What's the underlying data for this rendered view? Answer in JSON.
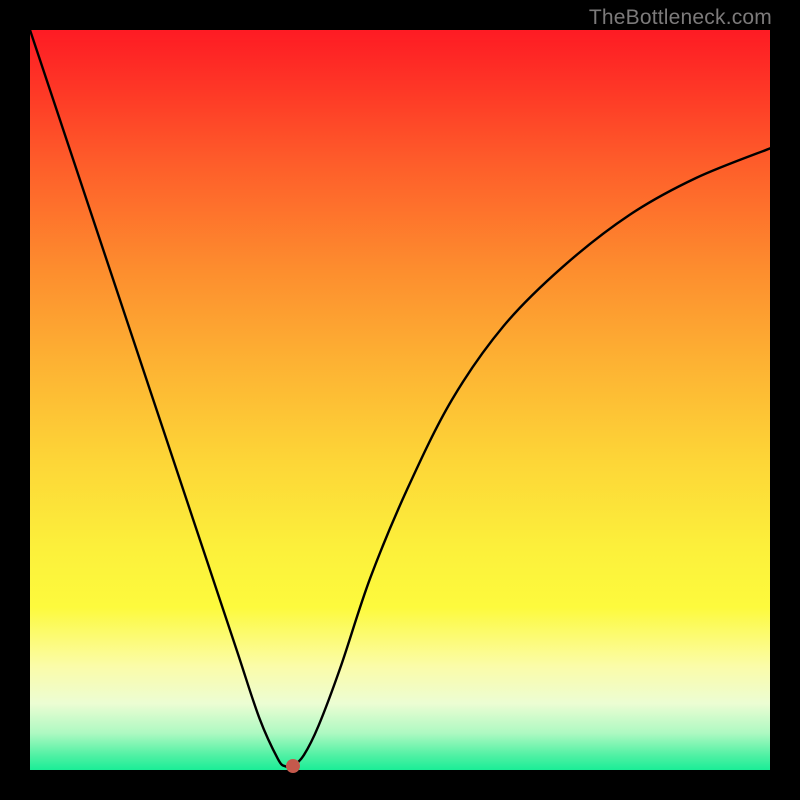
{
  "watermark": "TheBottleneck.com",
  "chart_data": {
    "type": "line",
    "title": "",
    "xlabel": "",
    "ylabel": "",
    "xlim": [
      0,
      100
    ],
    "ylim": [
      0,
      100
    ],
    "grid": false,
    "series": [
      {
        "name": "curve",
        "x": [
          0,
          4,
          8,
          12,
          16,
          20,
          24,
          28,
          31,
          33.5,
          34.5,
          35.5,
          37,
          39,
          42,
          46,
          51,
          57,
          64,
          72,
          81,
          90,
          100
        ],
        "values": [
          100,
          88,
          76,
          64,
          52,
          40,
          28,
          16,
          7,
          1.5,
          0.5,
          0.5,
          2,
          6,
          14,
          26,
          38,
          50,
          60,
          68,
          75,
          80,
          84
        ]
      }
    ],
    "marker": {
      "x": 35.5,
      "y": 0.5,
      "color": "#c5594c"
    },
    "background_gradient": {
      "top": "#fe1b24",
      "mid": "#fdd537",
      "bottom": "#1aed97"
    }
  }
}
